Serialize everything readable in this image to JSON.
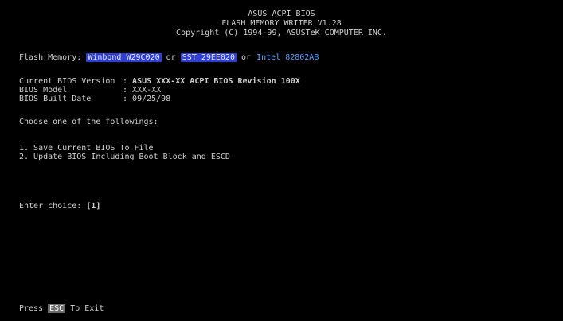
{
  "header": {
    "title": "ASUS ACPI BIOS",
    "subtitle": "FLASH MEMORY WRITER V1.28",
    "copyright": "Copyright (C) 1994-99, ASUSTeK COMPUTER INC."
  },
  "flash_memory": {
    "label": "Flash Memory:",
    "chips": [
      "Winbond W29C020",
      "SST 29EE020",
      "Intel 82802AB"
    ],
    "separator": "or"
  },
  "bios_info": [
    {
      "label": "Current BIOS Version",
      "value": "ASUS XXX-XX ACPI BIOS Revision 100X"
    },
    {
      "label": "BIOS Model",
      "value": "XXX-XX"
    },
    {
      "label": "BIOS Built Date",
      "value": "09/25/98"
    }
  ],
  "prompt": "Choose one of the followings:",
  "menu": {
    "items": [
      {
        "label": "1. Save Current BIOS To File"
      },
      {
        "label": "2. Update BIOS Including Boot Block and ESCD"
      }
    ]
  },
  "entry": {
    "label": "Enter choice:",
    "value": "[1]"
  },
  "footer": {
    "press": "Press",
    "key": "ESC",
    "action": "To Exit"
  },
  "colors": {
    "background": "#000000",
    "text": "#cfcfcf",
    "highlight_bg": "#2f3fd0",
    "highlight_text": "#5aa0ff"
  }
}
